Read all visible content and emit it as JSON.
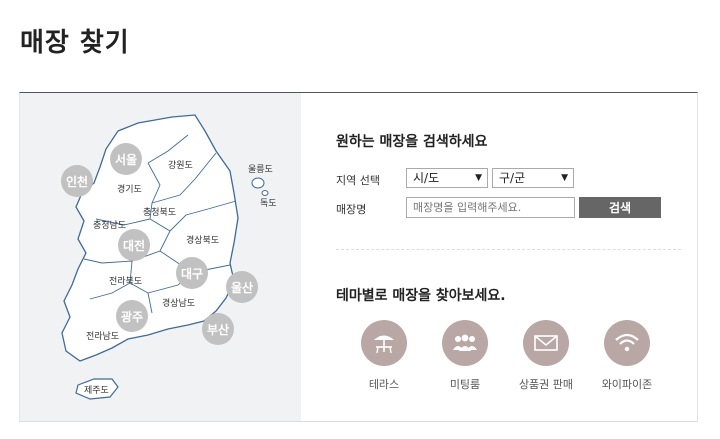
{
  "page_title": "매장 찾기",
  "map": {
    "regions": [
      "강원도",
      "경기도",
      "울릉도",
      "독도",
      "충청북도",
      "충청남도",
      "경상북도",
      "전라북도",
      "경상남도",
      "전라남도",
      "제주도"
    ],
    "cities": [
      "서울",
      "인천",
      "대전",
      "대구",
      "울산",
      "광주",
      "부산"
    ]
  },
  "search": {
    "heading": "원하는 매장을 검색하세요",
    "region_label": "지역 선택",
    "sido_value": "시/도",
    "gugun_value": "구/군",
    "store_label": "매장명",
    "store_placeholder": "매장명을 입력해주세요.",
    "search_button": "검색"
  },
  "theme": {
    "heading": "테마별로 매장을 찾아보세요.",
    "icon_color": "#b9a7a5",
    "items": [
      {
        "label": "테라스",
        "icon": "terrace-umbrella-icon"
      },
      {
        "label": "미팅룸",
        "icon": "meeting-people-icon"
      },
      {
        "label": "상품권 판매",
        "icon": "gift-card-envelope-icon"
      },
      {
        "label": "와이파이존",
        "icon": "wifi-icon"
      }
    ]
  }
}
